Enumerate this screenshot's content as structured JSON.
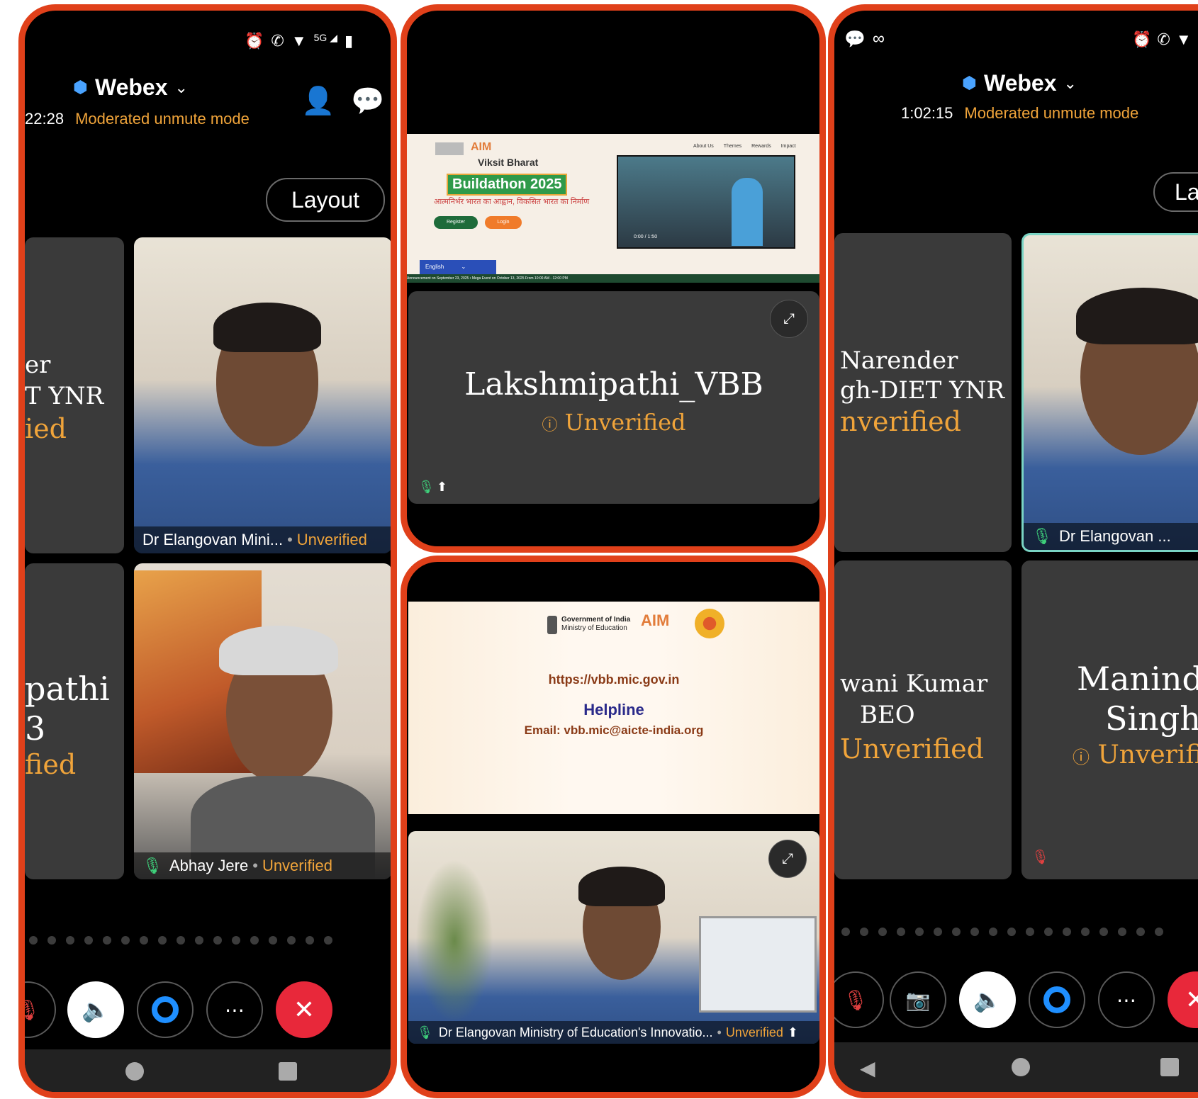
{
  "left_phone": {
    "app_title": "Webex",
    "timer": "22:28",
    "mode": "Moderated unmute mode",
    "layout_label": "Layout",
    "cut_tile_1": {
      "line1": "er",
      "line2": "T YNR",
      "line3": "ied"
    },
    "cut_tile_2": {
      "line1": "pathi",
      "line2": "3",
      "line3": "fied"
    },
    "video_1": {
      "name": "Dr Elangovan Mini...",
      "status": "Unverified"
    },
    "video_2": {
      "name": "Abhay Jere",
      "status": "Unverified"
    }
  },
  "middle_top": {
    "slide_brand": "AIM",
    "slide_title": "Buildathon 2025",
    "slide_title_prefix": "Viksit Bharat",
    "slide_tagline": "आत्मनिर्भर भारत का आह्वान, विकसित भारत का निर्माण",
    "register": "Register",
    "login": "Login",
    "nav_items": [
      "About Us",
      "Themes",
      "Rewards",
      "Impact"
    ],
    "language": "English",
    "ticker": "Announcement on September 23, 2025  •  Mega Event on October 13, 2025 From 10:00 AM - 12:00 PM",
    "video_time": "0:00 / 1:50",
    "participant_name": "Lakshmipathi_VBB",
    "participant_status": "Unverified"
  },
  "middle_bottom": {
    "gov_line1": "Government of India",
    "gov_line2": "Ministry of Education",
    "brand": "AIM",
    "url": "https://vbb.mic.gov.in",
    "helpline": "Helpline",
    "email": "Email: vbb.mic@aicte-india.org",
    "video_name": "Dr Elangovan Ministry of Education's Innovatio...",
    "video_status": "Unverified"
  },
  "right_phone": {
    "app_title": "Webex",
    "timer": "1:02:15",
    "mode": "Moderated unmute mode",
    "layout_label": "La",
    "tile_1": {
      "line1": "Narender",
      "line2": "gh-DIET YNR",
      "line3": "nverified"
    },
    "tile_2": {
      "line1": "wani Kumar",
      "line2": "BEO",
      "line3": "Unverified"
    },
    "tile_3": {
      "line1": "Manind",
      "line2": "Singh",
      "line3": "Unverifi"
    },
    "video_name": "Dr Elangovan ..."
  },
  "colors": {
    "frame": "#e0401a",
    "accent": "#f0a43a",
    "end_call": "#e8283a",
    "tile": "#3a3a3a",
    "green_dot": "#3ecf7a"
  }
}
